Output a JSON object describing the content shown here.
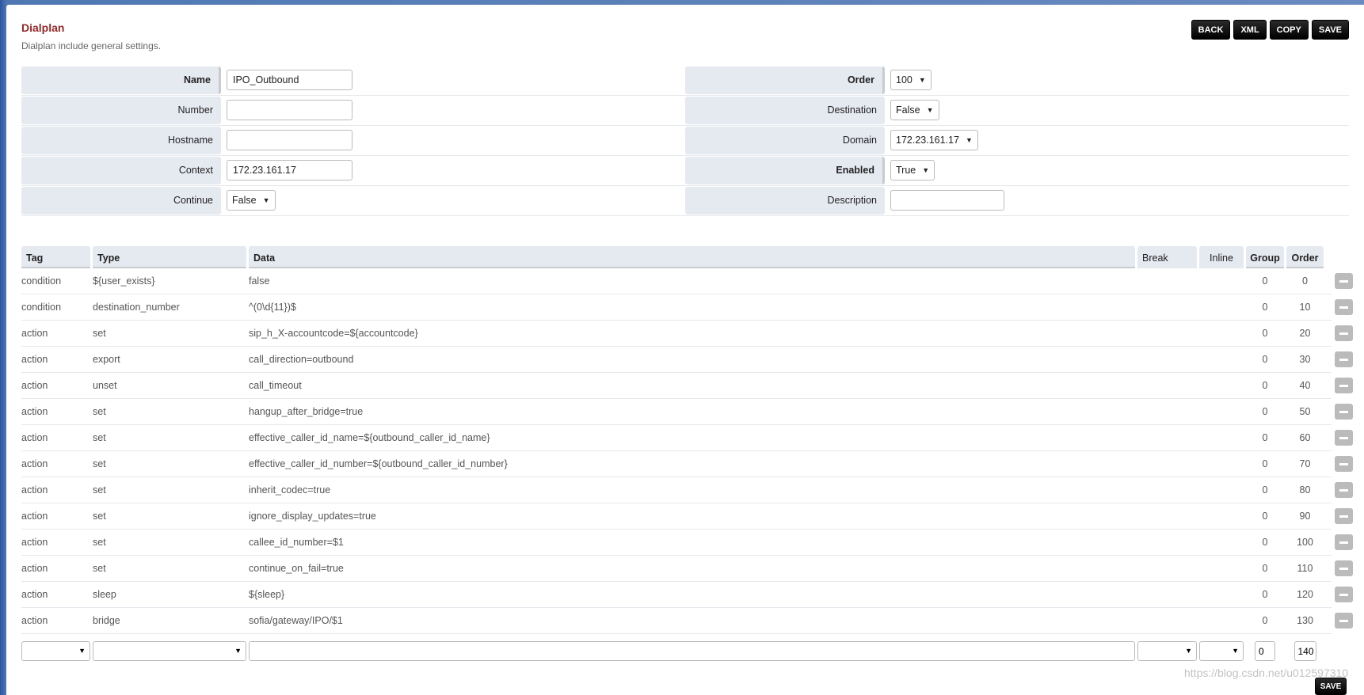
{
  "header": {
    "title": "Dialplan",
    "description": "Dialplan include general settings.",
    "buttons": [
      "BACK",
      "XML",
      "COPY",
      "SAVE"
    ]
  },
  "form": {
    "left": [
      {
        "label": "Name",
        "value": "IPO_Outbound",
        "kind": "input",
        "bold": true
      },
      {
        "label": "Number",
        "value": "",
        "kind": "input"
      },
      {
        "label": "Hostname",
        "value": "",
        "kind": "input"
      },
      {
        "label": "Context",
        "value": "172.23.161.17",
        "kind": "input"
      },
      {
        "label": "Continue",
        "value": "False",
        "kind": "select"
      }
    ],
    "right": [
      {
        "label": "Order",
        "value": "100",
        "kind": "select",
        "bold": true
      },
      {
        "label": "Destination",
        "value": "False",
        "kind": "select"
      },
      {
        "label": "Domain",
        "value": "172.23.161.17",
        "kind": "select"
      },
      {
        "label": "Enabled",
        "value": "True",
        "kind": "select",
        "bold": true
      },
      {
        "label": "Description",
        "value": "",
        "kind": "input"
      }
    ]
  },
  "table": {
    "headers": [
      "Tag",
      "Type",
      "Data",
      "Break",
      "Inline",
      "Group",
      "Order"
    ],
    "rows": [
      [
        "condition",
        "${user_exists}",
        "false",
        "",
        "",
        "0",
        "0"
      ],
      [
        "condition",
        "destination_number",
        "^(0\\d{11})$",
        "",
        "",
        "0",
        "10"
      ],
      [
        "action",
        "set",
        "sip_h_X-accountcode=${accountcode}",
        "",
        "",
        "0",
        "20"
      ],
      [
        "action",
        "export",
        "call_direction=outbound",
        "",
        "",
        "0",
        "30"
      ],
      [
        "action",
        "unset",
        "call_timeout",
        "",
        "",
        "0",
        "40"
      ],
      [
        "action",
        "set",
        "hangup_after_bridge=true",
        "",
        "",
        "0",
        "50"
      ],
      [
        "action",
        "set",
        "effective_caller_id_name=${outbound_caller_id_name}",
        "",
        "",
        "0",
        "60"
      ],
      [
        "action",
        "set",
        "effective_caller_id_number=${outbound_caller_id_number}",
        "",
        "",
        "0",
        "70"
      ],
      [
        "action",
        "set",
        "inherit_codec=true",
        "",
        "",
        "0",
        "80"
      ],
      [
        "action",
        "set",
        "ignore_display_updates=true",
        "",
        "",
        "0",
        "90"
      ],
      [
        "action",
        "set",
        "callee_id_number=$1",
        "",
        "",
        "0",
        "100"
      ],
      [
        "action",
        "set",
        "continue_on_fail=true",
        "",
        "",
        "0",
        "110"
      ],
      [
        "action",
        "sleep",
        "${sleep}",
        "",
        "",
        "0",
        "120"
      ],
      [
        "action",
        "bridge",
        "sofia/gateway/IPO/$1",
        "",
        "",
        "0",
        "130"
      ]
    ],
    "new_row": {
      "group": "0",
      "order": "140"
    }
  },
  "footer": {
    "save_label": "SAVE",
    "watermark": "https://blog.csdn.net/u012597310"
  },
  "colors": {
    "title": "#952a2a",
    "label_bg": "#e5e9f0",
    "button_bg": "#000000"
  }
}
